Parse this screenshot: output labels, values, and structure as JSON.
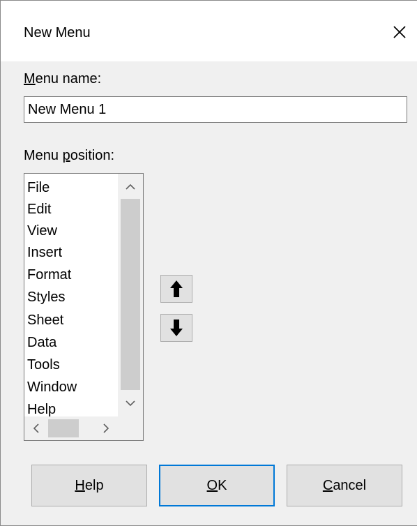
{
  "dialog": {
    "title": "New Menu",
    "close_icon": "close-icon"
  },
  "menu_name": {
    "label_prefix": "",
    "label_mnemonic": "M",
    "label_rest": "enu name:",
    "value": "New Menu 1"
  },
  "menu_position": {
    "label_prefix": "Menu ",
    "label_mnemonic": "p",
    "label_rest": "osition:",
    "items": [
      "File",
      "Edit",
      "View",
      "Insert",
      "Format",
      "Styles",
      "Sheet",
      "Data",
      "Tools",
      "Window",
      "Help"
    ]
  },
  "move": {
    "up_icon": "arrow-up-icon",
    "down_icon": "arrow-down-icon"
  },
  "buttons": {
    "help_mnemonic": "H",
    "help_rest": "elp",
    "ok_mnemonic": "O",
    "ok_rest": "K",
    "cancel_mnemonic": "C",
    "cancel_rest": "ancel"
  },
  "colors": {
    "accent": "#0078d7",
    "dialog_bg": "#f0f0f0",
    "button_bg": "#e1e1e1"
  }
}
